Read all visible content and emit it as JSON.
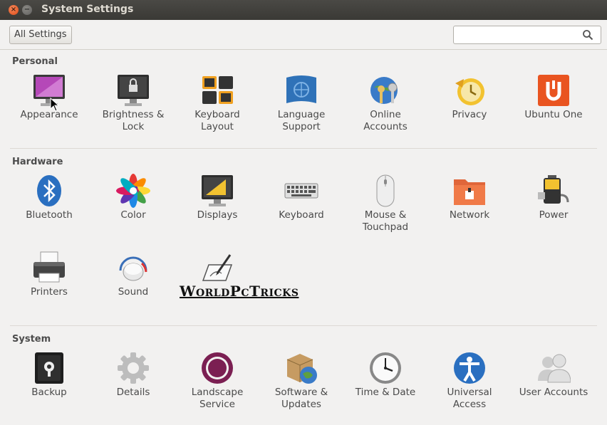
{
  "window": {
    "title": "System Settings"
  },
  "toolbar": {
    "all_settings_label": "All Settings",
    "search_placeholder": ""
  },
  "sections": {
    "personal": "Personal",
    "hardware": "Hardware",
    "system": "System"
  },
  "personal": [
    {
      "label": "Appearance",
      "icon": "appearance-icon"
    },
    {
      "label": "Brightness &\nLock",
      "icon": "brightness-lock-icon"
    },
    {
      "label": "Keyboard\nLayout",
      "icon": "keyboard-layout-icon"
    },
    {
      "label": "Language\nSupport",
      "icon": "language-support-icon"
    },
    {
      "label": "Online\nAccounts",
      "icon": "online-accounts-icon"
    },
    {
      "label": "Privacy",
      "icon": "privacy-icon"
    },
    {
      "label": "Ubuntu One",
      "icon": "ubuntu-one-icon"
    }
  ],
  "hardware": [
    {
      "label": "Bluetooth",
      "icon": "bluetooth-icon"
    },
    {
      "label": "Color",
      "icon": "color-icon"
    },
    {
      "label": "Displays",
      "icon": "displays-icon"
    },
    {
      "label": "Keyboard",
      "icon": "keyboard-icon"
    },
    {
      "label": "Mouse &\nTouchpad",
      "icon": "mouse-touchpad-icon"
    },
    {
      "label": "Network",
      "icon": "network-icon"
    },
    {
      "label": "Power",
      "icon": "power-icon"
    },
    {
      "label": "Printers",
      "icon": "printers-icon"
    },
    {
      "label": "Sound",
      "icon": "sound-icon"
    },
    {
      "label": "",
      "icon": "wacom-tablet-icon"
    }
  ],
  "system": [
    {
      "label": "Backup",
      "icon": "backup-icon"
    },
    {
      "label": "Details",
      "icon": "details-icon"
    },
    {
      "label": "Landscape\nService",
      "icon": "landscape-service-icon"
    },
    {
      "label": "Software &\nUpdates",
      "icon": "software-updates-icon"
    },
    {
      "label": "Time & Date",
      "icon": "time-date-icon"
    },
    {
      "label": "Universal\nAccess",
      "icon": "universal-access-icon"
    },
    {
      "label": "User Accounts",
      "icon": "user-accounts-icon"
    }
  ],
  "watermark": "WorldPcTricks"
}
